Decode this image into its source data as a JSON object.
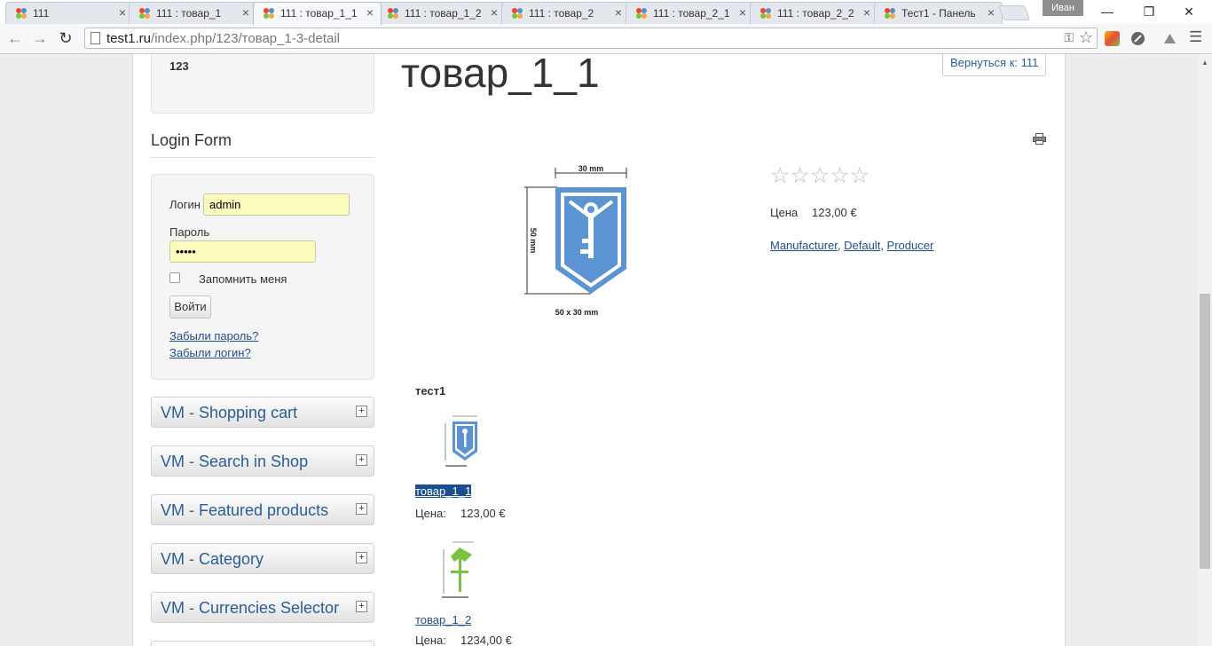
{
  "browser": {
    "tabs": [
      {
        "title": "111",
        "active": false
      },
      {
        "title": "111 : товар_1",
        "active": false
      },
      {
        "title": "111 : товар_1_1",
        "active": true
      },
      {
        "title": "111 : товар_1_2",
        "active": false
      },
      {
        "title": "111 : товар_2",
        "active": false
      },
      {
        "title": "111 : товар_2_1",
        "active": false
      },
      {
        "title": "111 : товар_2_2",
        "active": false
      },
      {
        "title": "Тест1 - Панель",
        "active": false
      }
    ],
    "close_glyph": "×",
    "user": "Иван",
    "url_host": "test1.ru",
    "url_path": "/index.php/123/товар_1-3-detail",
    "colors": {
      "tab_bg": "#e4e8ee",
      "active_tab_bg": "#f6f7f9",
      "link": "#22508c",
      "module_title": "#2a5e97"
    }
  },
  "sidebar": {
    "top_well_text": "123",
    "login": {
      "heading": "Login Form",
      "username_label": "Логин",
      "username_value": "admin",
      "password_label": "Пароль",
      "password_value": "•••••",
      "remember_label": "Запомнить меня",
      "remember_checked": false,
      "submit_label": "Войти",
      "forgot_password": "Забыли пароль?",
      "forgot_login": "Забыли логин?"
    },
    "modules": [
      {
        "title": "VM - Shopping cart",
        "toggle": "+"
      },
      {
        "title": "VM - Search in Shop",
        "toggle": "+"
      },
      {
        "title": "VM - Featured products",
        "toggle": "+"
      },
      {
        "title": "VM - Category",
        "toggle": "+"
      },
      {
        "title": "VM - Currencies Selector",
        "toggle": "+"
      }
    ]
  },
  "product": {
    "title": "товар_1_1",
    "back_label": "Вернуться к: 111",
    "rating_stars": "☆☆☆☆☆",
    "rating_value": 0,
    "price_label": "Цена",
    "price_value": "123,00 €",
    "manufacturers": [
      "Manufacturer",
      "Default",
      "Producer"
    ],
    "image_labels": {
      "width": "30 mm",
      "height": "50 mm",
      "size": "50 x 30 mm"
    }
  },
  "related": {
    "heading": "тест1",
    "items": [
      {
        "name": "товар_1_1",
        "price_label": "Цена:",
        "price": "123,00 €",
        "selected": true
      },
      {
        "name": "товар_1_2",
        "price_label": "Цена:",
        "price": "1234,00 €",
        "selected": false
      }
    ]
  }
}
